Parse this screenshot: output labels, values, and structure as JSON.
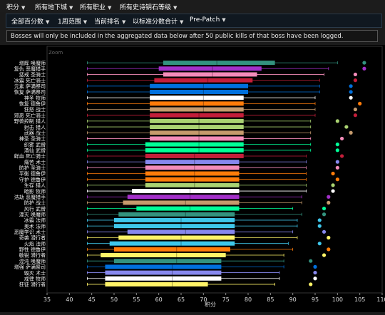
{
  "nav": {
    "items": [
      {
        "label": "积分",
        "name": "nav-score"
      },
      {
        "label": "所有地下城",
        "name": "nav-dungeons"
      },
      {
        "label": "所有职业",
        "name": "nav-classes"
      },
      {
        "label": "所有史诗钥石等级",
        "name": "nav-keystone-levels"
      }
    ]
  },
  "filters": {
    "items": [
      {
        "label": "全部百分数",
        "name": "filter-percentile"
      },
      {
        "label": "1周范围",
        "name": "filter-range"
      },
      {
        "label": "当前排名",
        "name": "filter-ranking"
      },
      {
        "label": "以标准分数合计",
        "name": "filter-aggregation"
      },
      {
        "label": "Pre-Patch",
        "name": "filter-patch"
      }
    ]
  },
  "notice": {
    "text": "Bosses will only be included in the aggregated data below after 50 public kills of that boss have been logged."
  },
  "chart_data": {
    "type": "boxplot",
    "orientation": "horizontal",
    "title": "",
    "xlabel": "积分",
    "ylabel": "",
    "xlim": [
      35,
      110
    ],
    "xticks": [
      35,
      40,
      45,
      50,
      55,
      60,
      65,
      70,
      75,
      80,
      85,
      90,
      95,
      100,
      105,
      110
    ],
    "annotation": "Zoom",
    "grid": false,
    "series": [
      {
        "label": "增辉 唤魔师",
        "color": "#33937F",
        "min": 44,
        "q1": 61,
        "median": 73,
        "q3": 86,
        "max": 100,
        "outlier": 106
      },
      {
        "label": "复仇 恶魔猎手",
        "color": "#A330C9",
        "min": 44,
        "q1": 60,
        "median": 72,
        "q3": 83,
        "max": 98,
        "outlier": 106
      },
      {
        "label": "惩戒 圣骑士",
        "color": "#F48CBA",
        "min": 44,
        "q1": 61,
        "median": 72,
        "q3": 82,
        "max": 97,
        "outlier": 104
      },
      {
        "label": "冰霜 死亡骑士",
        "color": "#C41E3A",
        "min": 44,
        "q1": 59,
        "median": 71,
        "q3": 81,
        "max": 96,
        "outlier": 104
      },
      {
        "label": "元素 萨满祭司",
        "color": "#0070DD",
        "min": 44,
        "q1": 58,
        "median": 70,
        "q3": 80,
        "max": 96,
        "outlier": 103
      },
      {
        "label": "恢复 萨满祭司",
        "color": "#0070DD",
        "min": 44,
        "q1": 58,
        "median": 70,
        "q3": 80,
        "max": 96,
        "outlier": 103
      },
      {
        "label": "神圣 牧师",
        "color": "#FFFFFF",
        "min": 44,
        "q1": 58,
        "median": 70,
        "q3": 79,
        "max": 95,
        "outlier": 103
      },
      {
        "label": "恢复 德鲁伊",
        "color": "#FF7C0A",
        "min": 44,
        "q1": 58,
        "median": 70,
        "q3": 79,
        "max": 95,
        "outlier": 105
      },
      {
        "label": "狂怒 战士",
        "color": "#C69B6D",
        "min": 44,
        "q1": 58,
        "median": 70,
        "q3": 79,
        "max": 95,
        "outlier": 104
      },
      {
        "label": "邪恶 死亡骑士",
        "color": "#C41E3A",
        "min": 44,
        "q1": 58,
        "median": 69,
        "q3": 79,
        "max": 95,
        "outlier": 104
      },
      {
        "label": "野兽控制 猎人",
        "color": "#AAD372",
        "min": 44,
        "q1": 58,
        "median": 69,
        "q3": 79,
        "max": 94,
        "outlier": 100
      },
      {
        "label": "射击 猎人",
        "color": "#AAD372",
        "min": 44,
        "q1": 58,
        "median": 69,
        "q3": 79,
        "max": 94,
        "outlier": 102
      },
      {
        "label": "武器 战士",
        "color": "#C69B6D",
        "min": 44,
        "q1": 58,
        "median": 69,
        "q3": 79,
        "max": 94,
        "outlier": 103
      },
      {
        "label": "神圣 圣骑士",
        "color": "#F48CBA",
        "min": 44,
        "q1": 58,
        "median": 69,
        "q3": 79,
        "max": 94,
        "outlier": 101
      },
      {
        "label": "织雾 武僧",
        "color": "#00FF98",
        "min": 44,
        "q1": 57,
        "median": 69,
        "q3": 79,
        "max": 94,
        "outlier": 100
      },
      {
        "label": "酒仙 武僧",
        "color": "#00FF98",
        "min": 44,
        "q1": 57,
        "median": 69,
        "q3": 79,
        "max": 94,
        "outlier": 100
      },
      {
        "label": "鲜血 死亡骑士",
        "color": "#C41E3A",
        "min": 44,
        "q1": 57,
        "median": 68,
        "q3": 79,
        "max": 93,
        "outlier": 101
      },
      {
        "label": "痛苦 术士",
        "color": "#8788EE",
        "min": 44,
        "q1": 57,
        "median": 68,
        "q3": 78,
        "max": 93,
        "outlier": 100
      },
      {
        "label": "防护 圣骑士",
        "color": "#F48CBA",
        "min": 44,
        "q1": 57,
        "median": 68,
        "q3": 78,
        "max": 93,
        "outlier": 100
      },
      {
        "label": "平衡 德鲁伊",
        "color": "#FF7C0A",
        "min": 44,
        "q1": 57,
        "median": 68,
        "q3": 78,
        "max": 93,
        "outlier": 99
      },
      {
        "label": "守护 德鲁伊",
        "color": "#FF7C0A",
        "min": 44,
        "q1": 57,
        "median": 68,
        "q3": 78,
        "max": 93,
        "outlier": 100
      },
      {
        "label": "生存 猎人",
        "color": "#AAD372",
        "min": 44,
        "q1": 57,
        "median": 68,
        "q3": 78,
        "max": 93,
        "outlier": 99
      },
      {
        "label": "暗影 牧师",
        "color": "#FFFFFF",
        "min": 44,
        "q1": 54,
        "median": 67,
        "q3": 78,
        "max": 93,
        "outlier": 99
      },
      {
        "label": "浩劫 恶魔猎手",
        "color": "#A330C9",
        "min": 44,
        "q1": 53,
        "median": 67,
        "q3": 78,
        "max": 92,
        "outlier": 98
      },
      {
        "label": "防护 战士",
        "color": "#C69B6D",
        "min": 44,
        "q1": 52,
        "median": 66,
        "q3": 78,
        "max": 92,
        "outlier": 98
      },
      {
        "label": "风行 武僧",
        "color": "#00FF98",
        "min": 44,
        "q1": 55,
        "median": 67,
        "q3": 78,
        "max": 90,
        "outlier": 97
      },
      {
        "label": "湮灭 唤魔师",
        "color": "#33937F",
        "min": 44,
        "q1": 51,
        "median": 66,
        "q3": 77,
        "max": 92,
        "outlier": 97
      },
      {
        "label": "冰霜 法师",
        "color": "#3FC7EB",
        "min": 44,
        "q1": 50,
        "median": 65,
        "q3": 77,
        "max": 91,
        "outlier": 96
      },
      {
        "label": "奥术 法师",
        "color": "#3FC7EB",
        "min": 44,
        "q1": 50,
        "median": 65,
        "q3": 77,
        "max": 91,
        "outlier": 96
      },
      {
        "label": "恶魔学识 术士",
        "color": "#8788EE",
        "min": 44,
        "q1": 53,
        "median": 66,
        "q3": 77,
        "max": 90,
        "outlier": 97
      },
      {
        "label": "奇袭 潜行者",
        "color": "#FFF468",
        "min": 44,
        "q1": 51,
        "median": 65,
        "q3": 77,
        "max": 91,
        "outlier": 98
      },
      {
        "label": "火焰 法师",
        "color": "#3FC7EB",
        "min": 44,
        "q1": 49,
        "median": 65,
        "q3": 77,
        "max": 89,
        "outlier": 96
      },
      {
        "label": "野性 德鲁伊",
        "color": "#FF7C0A",
        "min": 44,
        "q1": 50,
        "median": 64,
        "q3": 76,
        "max": 90,
        "outlier": 98
      },
      {
        "label": "敏锐 潜行者",
        "color": "#FFF468",
        "min": 44,
        "q1": 47,
        "median": 64,
        "q3": 75,
        "max": 88,
        "outlier": 97
      },
      {
        "label": "混沌 唤魔师",
        "color": "#33937F",
        "min": 44,
        "q1": 50,
        "median": 64,
        "q3": 74,
        "max": 88,
        "outlier": 94
      },
      {
        "label": "增强 萨满祭司",
        "color": "#0070DD",
        "min": 44,
        "q1": 48,
        "median": 63,
        "q3": 74,
        "max": 88,
        "outlier": 95
      },
      {
        "label": "毁灭 术士",
        "color": "#8788EE",
        "min": 44,
        "q1": 48,
        "median": 63,
        "q3": 74,
        "max": 87,
        "outlier": 95
      },
      {
        "label": "戒律 牧师",
        "color": "#FFFFFF",
        "min": 44,
        "q1": 48,
        "median": 63,
        "q3": 74,
        "max": 87,
        "outlier": 95
      },
      {
        "label": "狂徒 潜行者",
        "color": "#FFF468",
        "min": 44,
        "q1": 48,
        "median": 63,
        "q3": 71,
        "max": 86,
        "outlier": 94
      }
    ]
  }
}
